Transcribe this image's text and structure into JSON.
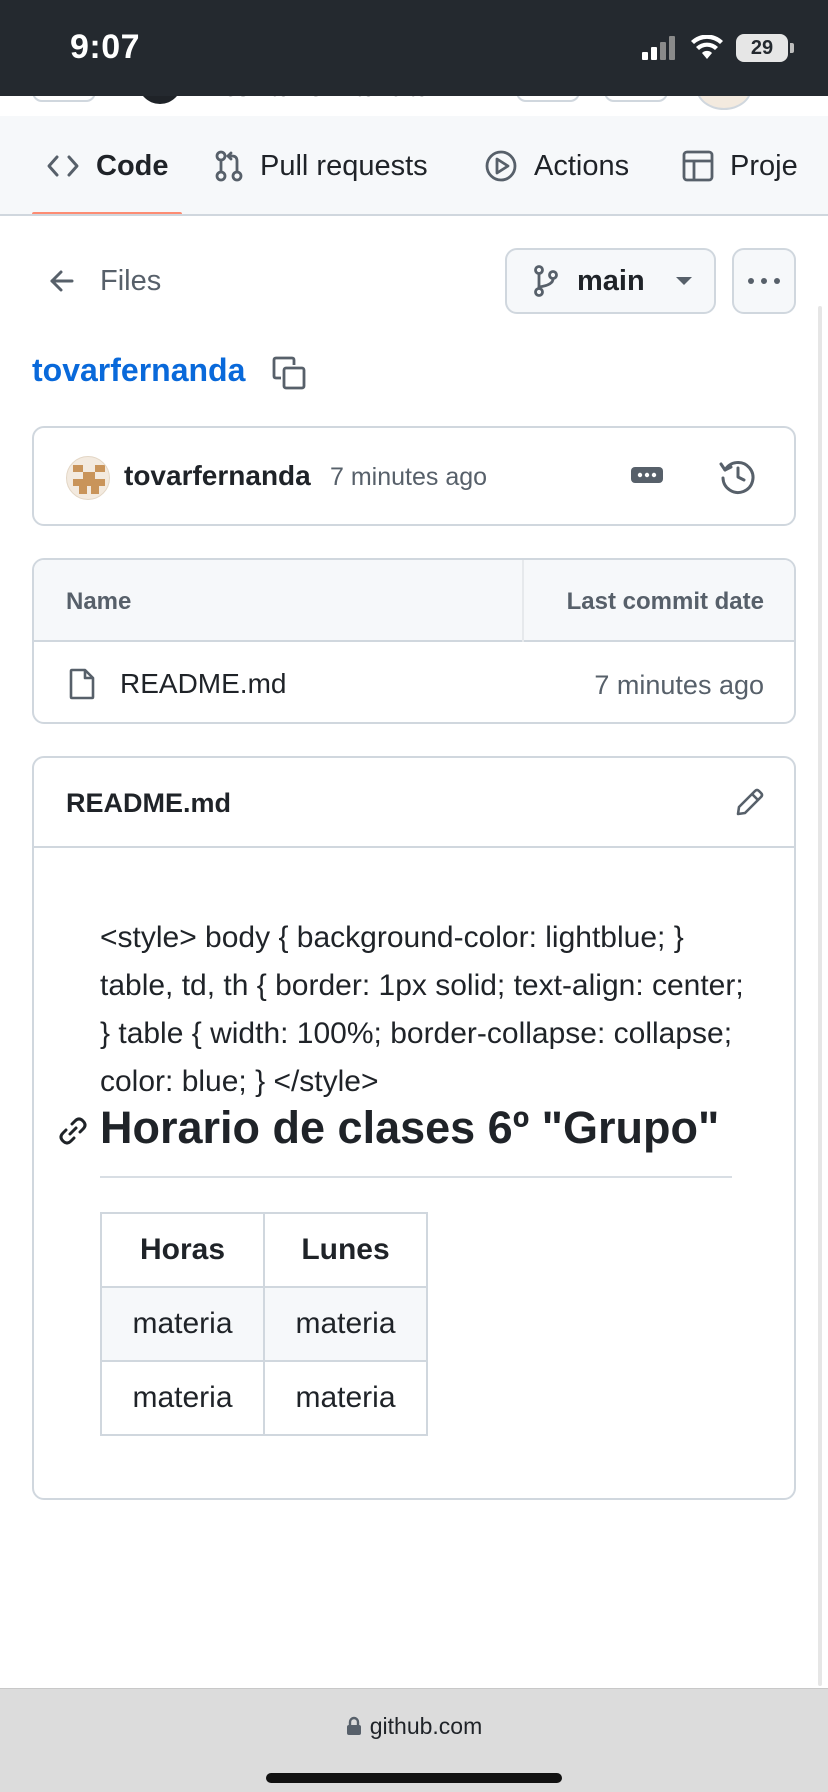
{
  "status_bar": {
    "time": "9:07",
    "battery": "29"
  },
  "repo_header_peek": {
    "text": "tovarfernanda"
  },
  "tabs": [
    {
      "label": "Code",
      "icon": "code-icon",
      "active": true
    },
    {
      "label": "Pull requests",
      "icon": "git-pull-request-icon",
      "active": false
    },
    {
      "label": "Actions",
      "icon": "play-icon",
      "active": false
    },
    {
      "label": "Proje",
      "icon": "table-icon",
      "active": false
    }
  ],
  "colors": {
    "link": "#0969da",
    "tab_underline": "#fd8c73",
    "border": "#d0d7de",
    "muted_text": "#57606a"
  },
  "files_nav": {
    "back_label": "Files",
    "branch": "main"
  },
  "repo": {
    "owner": "tovarfernanda"
  },
  "latest_commit": {
    "author": "tovarfernanda",
    "time": "7 minutes ago"
  },
  "file_table": {
    "columns": [
      "Name",
      "Last commit date"
    ],
    "rows": [
      {
        "name": "README.md",
        "date": "7 minutes ago",
        "icon": "file-icon"
      }
    ]
  },
  "readme": {
    "title": "README.md",
    "style_text": "<style> body { background-color: lightblue; } table, td, th { border: 1px solid; text-align: center; } table { width: 100%; border-collapse: collapse; color: blue; } </style>",
    "heading": "Horario de clases 6º \"Grupo\"",
    "table": {
      "headers": [
        "Horas",
        "Lunes"
      ],
      "rows": [
        [
          "materia",
          "materia"
        ],
        [
          "materia",
          "materia"
        ]
      ]
    }
  },
  "browser": {
    "url": "github.com"
  }
}
